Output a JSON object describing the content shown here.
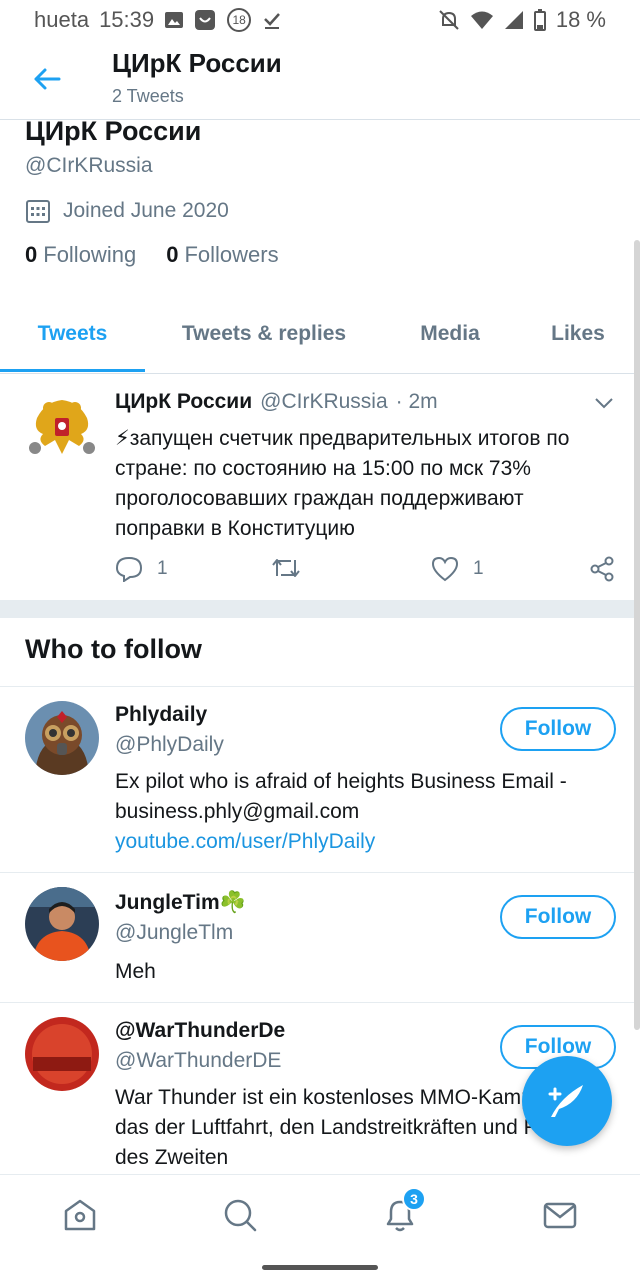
{
  "status_bar": {
    "carrier": "hueta",
    "time": "15:39",
    "notif_count": "18",
    "battery": "18 %"
  },
  "header": {
    "title": "ЦИрК России",
    "subtitle": "2 Tweets"
  },
  "profile": {
    "name": "ЦИрК России",
    "handle": "@CIrKRussia",
    "joined": "Joined June 2020",
    "following_count": "0",
    "following_label": "Following",
    "followers_count": "0",
    "followers_label": "Followers"
  },
  "tabs": [
    {
      "label": "Tweets",
      "active": true
    },
    {
      "label": "Tweets & replies",
      "active": false
    },
    {
      "label": "Media",
      "active": false
    },
    {
      "label": "Likes",
      "active": false
    }
  ],
  "tweet": {
    "name": "ЦИрК России",
    "handle": "@CIrKRussia",
    "time": "· 2m",
    "text": "⚡запущен счетчик предварительных итогов по стране: по состоянию на 15:00 по мск 73% проголосовавших граждан поддерживают поправки в Конституцию",
    "reply_count": "1",
    "like_count": "1"
  },
  "who_to_follow": {
    "title": "Who to follow",
    "follow_label": "Follow",
    "items": [
      {
        "name": "Phlydaily",
        "handle": "@PhlyDaily",
        "bio": "Ex pilot who is afraid of heights Business Email - business.phly@gmail.com",
        "link": "youtube.com/user/PhlyDaily"
      },
      {
        "name": "JungleTim☘️",
        "handle": "@JungleTlm",
        "bio": "Meh"
      },
      {
        "name": "@WarThunderDe",
        "handle": "@WarThunderDE",
        "bio": "War Thunder ist ein kostenloses MMO-Kampfspiel, das der Luftfahrt, den Landstreitkräften und Flotten des Zweiten"
      }
    ]
  },
  "bottom_nav": {
    "notifications_badge": "3"
  },
  "colors": {
    "accent": "#1da1f2",
    "text": "#14171a",
    "secondary": "#657786"
  }
}
